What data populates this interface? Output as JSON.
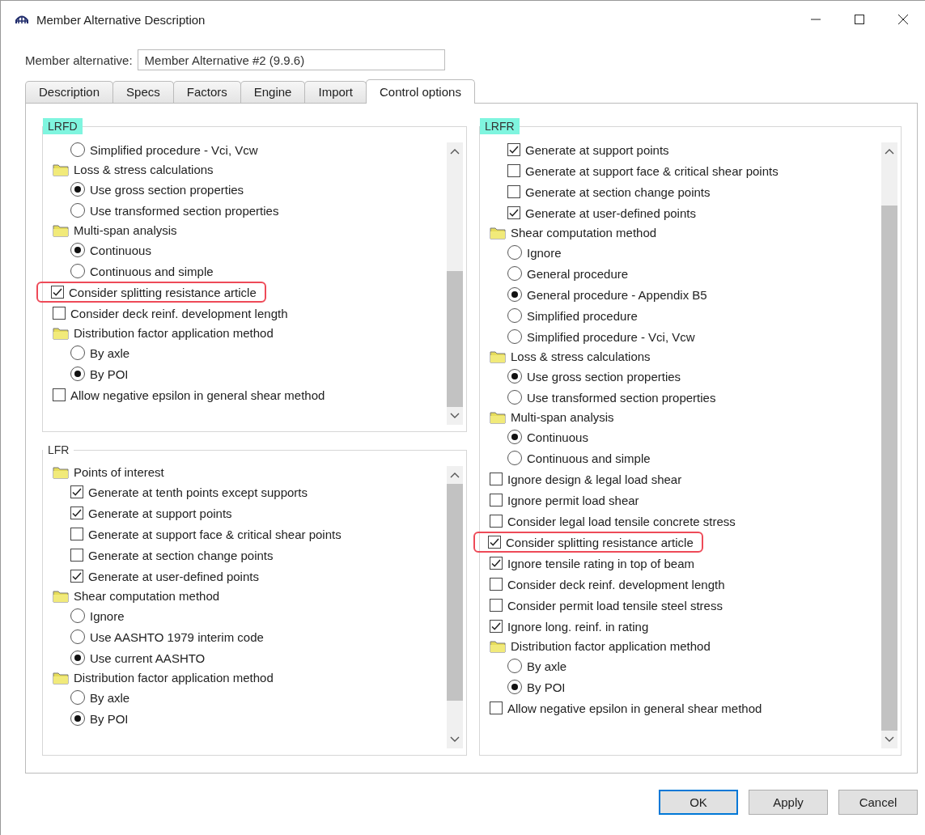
{
  "window": {
    "title": "Member Alternative Description"
  },
  "member_alternative": {
    "label": "Member alternative:",
    "value": "Member Alternative #2 (9.9.6)"
  },
  "tabs": [
    {
      "label": "Description",
      "selected": false
    },
    {
      "label": "Specs",
      "selected": false
    },
    {
      "label": "Factors",
      "selected": false
    },
    {
      "label": "Engine",
      "selected": false
    },
    {
      "label": "Import",
      "selected": false
    },
    {
      "label": "Control options",
      "selected": true
    }
  ],
  "groups": [
    {
      "title": "LRFD",
      "highlighted": true,
      "items": [
        {
          "kind": "group",
          "children": [
            {
              "kind": "radio",
              "label": "Simplified procedure - Vci, Vcw",
              "selected": false
            }
          ]
        },
        {
          "kind": "folder",
          "label": "Loss & stress calculations",
          "children": [
            {
              "kind": "radio",
              "label": "Use gross section properties",
              "selected": true
            },
            {
              "kind": "radio",
              "label": "Use transformed section properties",
              "selected": false
            }
          ]
        },
        {
          "kind": "folder",
          "label": "Multi-span analysis",
          "children": [
            {
              "kind": "radio",
              "label": "Continuous",
              "selected": true
            },
            {
              "kind": "radio",
              "label": "Continuous and simple",
              "selected": false
            }
          ]
        },
        {
          "kind": "checkbox",
          "label": "Consider splitting resistance article",
          "checked": true,
          "highlighted": true
        },
        {
          "kind": "checkbox",
          "label": "Consider deck reinf. development length",
          "checked": false,
          "highlighted": false
        },
        {
          "kind": "folder",
          "label": "Distribution factor application method",
          "children": [
            {
              "kind": "radio",
              "label": "By axle",
              "selected": false
            },
            {
              "kind": "radio",
              "label": "By POI",
              "selected": true
            }
          ]
        },
        {
          "kind": "checkbox",
          "label": "Allow negative epsilon in general shear method",
          "checked": false,
          "highlighted": false
        }
      ]
    },
    {
      "title": "LFR",
      "highlighted": false,
      "items": [
        {
          "kind": "folder",
          "label": "Points of interest",
          "children": [
            {
              "kind": "checkbox",
              "label": "Generate at tenth points except supports",
              "checked": true,
              "highlighted": false
            },
            {
              "kind": "checkbox",
              "label": "Generate at support points",
              "checked": true,
              "highlighted": false
            },
            {
              "kind": "checkbox",
              "label": "Generate at support face & critical shear points",
              "checked": false,
              "highlighted": false
            },
            {
              "kind": "checkbox",
              "label": "Generate at section change points",
              "checked": false,
              "highlighted": false
            },
            {
              "kind": "checkbox",
              "label": "Generate at user-defined points",
              "checked": true,
              "highlighted": false
            }
          ]
        },
        {
          "kind": "folder",
          "label": "Shear computation method",
          "children": [
            {
              "kind": "radio",
              "label": "Ignore",
              "selected": false
            },
            {
              "kind": "radio",
              "label": "Use AASHTO 1979 interim code",
              "selected": false
            },
            {
              "kind": "radio",
              "label": "Use current AASHTO",
              "selected": true
            }
          ]
        },
        {
          "kind": "folder",
          "label": "Distribution factor application method",
          "children": [
            {
              "kind": "radio",
              "label": "By axle",
              "selected": false
            },
            {
              "kind": "radio",
              "label": "By POI",
              "selected": true
            }
          ]
        }
      ]
    },
    {
      "title": "LRFR",
      "highlighted": true,
      "items": [
        {
          "kind": "group",
          "children": [
            {
              "kind": "checkbox",
              "label": "Generate at support points",
              "checked": true,
              "highlighted": false
            },
            {
              "kind": "checkbox",
              "label": "Generate at support face & critical shear points",
              "checked": false,
              "highlighted": false
            },
            {
              "kind": "checkbox",
              "label": "Generate at section change points",
              "checked": false,
              "highlighted": false
            },
            {
              "kind": "checkbox",
              "label": "Generate at user-defined points",
              "checked": true,
              "highlighted": false
            }
          ]
        },
        {
          "kind": "folder",
          "label": "Shear computation method",
          "children": [
            {
              "kind": "radio",
              "label": "Ignore",
              "selected": false
            },
            {
              "kind": "radio",
              "label": "General procedure",
              "selected": false
            },
            {
              "kind": "radio",
              "label": "General procedure - Appendix B5",
              "selected": true
            },
            {
              "kind": "radio",
              "label": "Simplified procedure",
              "selected": false
            },
            {
              "kind": "radio",
              "label": "Simplified procedure - Vci, Vcw",
              "selected": false
            }
          ]
        },
        {
          "kind": "folder",
          "label": "Loss & stress calculations",
          "children": [
            {
              "kind": "radio",
              "label": "Use gross section properties",
              "selected": true
            },
            {
              "kind": "radio",
              "label": "Use transformed section properties",
              "selected": false
            }
          ]
        },
        {
          "kind": "folder",
          "label": "Multi-span analysis",
          "children": [
            {
              "kind": "radio",
              "label": "Continuous",
              "selected": true
            },
            {
              "kind": "radio",
              "label": "Continuous and simple",
              "selected": false
            }
          ]
        },
        {
          "kind": "checkbox",
          "label": "Ignore design & legal load shear",
          "checked": false,
          "highlighted": false
        },
        {
          "kind": "checkbox",
          "label": "Ignore permit load shear",
          "checked": false,
          "highlighted": false
        },
        {
          "kind": "checkbox",
          "label": "Consider legal load tensile concrete stress",
          "checked": false,
          "highlighted": false
        },
        {
          "kind": "checkbox",
          "label": "Consider splitting resistance article",
          "checked": true,
          "highlighted": true
        },
        {
          "kind": "checkbox",
          "label": "Ignore tensile rating in top of beam",
          "checked": true,
          "highlighted": false
        },
        {
          "kind": "checkbox",
          "label": "Consider deck reinf. development length",
          "checked": false,
          "highlighted": false
        },
        {
          "kind": "checkbox",
          "label": "Consider permit load tensile steel stress",
          "checked": false,
          "highlighted": false
        },
        {
          "kind": "checkbox",
          "label": "Ignore long. reinf. in rating",
          "checked": true,
          "highlighted": false
        },
        {
          "kind": "folder",
          "label": "Distribution factor application method",
          "children": [
            {
              "kind": "radio",
              "label": "By axle",
              "selected": false
            },
            {
              "kind": "radio",
              "label": "By POI",
              "selected": true
            }
          ]
        },
        {
          "kind": "checkbox",
          "label": "Allow negative epsilon in general shear method",
          "checked": false,
          "highlighted": false
        }
      ]
    }
  ],
  "buttons": [
    {
      "label": "OK",
      "default": true
    },
    {
      "label": "Apply",
      "default": false
    },
    {
      "label": "Cancel",
      "default": false
    }
  ]
}
